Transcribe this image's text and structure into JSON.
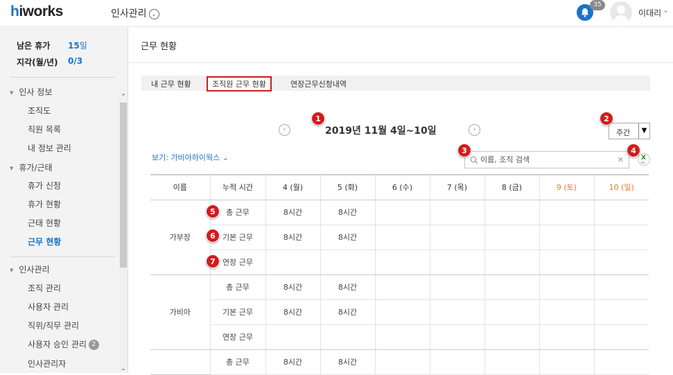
{
  "header": {
    "logo": "hiworks",
    "app_title": "인사관리",
    "notification_count": "35",
    "user_name": "이대리"
  },
  "sidebar": {
    "stats": [
      {
        "label": "남은 휴가",
        "value": "15",
        "unit": "일"
      },
      {
        "label": "지각(월/년)",
        "value": "0/3",
        "unit": ""
      }
    ],
    "sections": [
      {
        "label": "인사 정보",
        "items": [
          "조직도",
          "직원 목록",
          "내 정보 관리"
        ]
      },
      {
        "label": "휴가/근태",
        "items": [
          "휴가 신청",
          "휴가 현황",
          "근태 현황",
          "근무 현황"
        ]
      },
      {
        "label": "인사관리",
        "items": [
          "조직 관리",
          "사용자 관리",
          "직위/직무 관리",
          "사용자 승인 관리",
          "인사관리자"
        ]
      }
    ],
    "pending_badge": "2",
    "active_item": "근무 현황"
  },
  "main": {
    "page_title": "근무 현황",
    "tabs": [
      "내 근무 현황",
      "조직원 근무 현황",
      "연장근무신청내역"
    ],
    "active_tab": "조직원 근무 현황",
    "date_range": "2019년 11월 4일~10일",
    "view_select": "주간",
    "view_by": "보기: 가비아하이웍스",
    "search_placeholder": "이름, 조직 검색",
    "table": {
      "headers": [
        "이름",
        "누적 시간",
        "4 (월)",
        "5 (화)",
        "6 (수)",
        "7 (목)",
        "8 (금)",
        "9 (토)",
        "10 (일)"
      ],
      "groups": [
        {
          "name": "가부장",
          "rows": [
            {
              "label": "총 근무",
              "cells": [
                "8시간",
                "8시간",
                "",
                "",
                "",
                "",
                ""
              ]
            },
            {
              "label": "기본 근무",
              "cells": [
                "8시간",
                "8시간",
                "",
                "",
                "",
                "",
                ""
              ]
            },
            {
              "label": "연장 근무",
              "cells": [
                "",
                "",
                "",
                "",
                "",
                "",
                ""
              ]
            }
          ]
        },
        {
          "name": "가비아",
          "rows": [
            {
              "label": "총 근무",
              "cells": [
                "8시간",
                "8시간",
                "",
                "",
                "",
                "",
                ""
              ]
            },
            {
              "label": "기본 근무",
              "cells": [
                "8시간",
                "8시간",
                "",
                "",
                "",
                "",
                ""
              ]
            },
            {
              "label": "연장 근무",
              "cells": [
                "",
                "",
                "",
                "",
                "",
                "",
                ""
              ]
            }
          ]
        },
        {
          "name": "",
          "rows": [
            {
              "label": "총 근무",
              "cells": [
                "8시간",
                "8시간",
                "",
                "",
                "",
                "",
                ""
              ]
            }
          ]
        }
      ]
    }
  },
  "annotations": [
    "1",
    "2",
    "3",
    "4",
    "5",
    "6",
    "7"
  ],
  "colors": {
    "accent": "#1a73c9",
    "marker": "#d31c1c",
    "weekend": "#e8792c"
  }
}
